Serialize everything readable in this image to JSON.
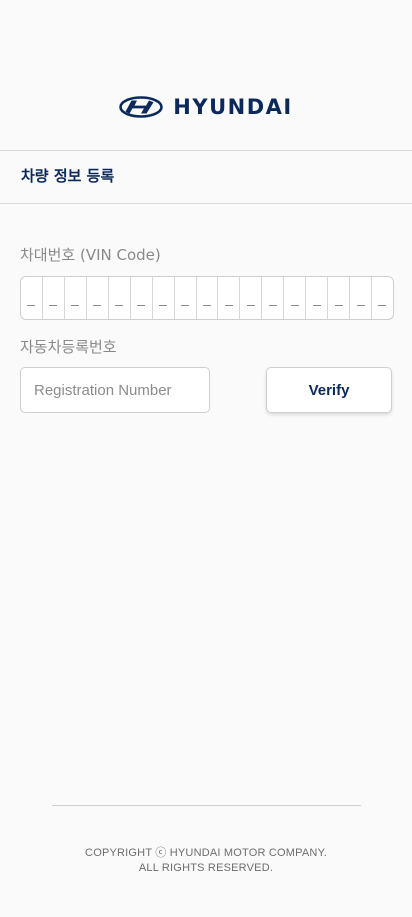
{
  "brand": {
    "name": "HYUNDAI",
    "color": "#0b2a5b"
  },
  "section": {
    "title": "차량 정보 등록"
  },
  "vin": {
    "label": "차대번호 (VIN Code)",
    "cells": [
      "_",
      "_",
      "_",
      "_",
      "_",
      "_",
      "_",
      "_",
      "_",
      "_",
      "_",
      "_",
      "_",
      "_",
      "_",
      "_",
      "_"
    ]
  },
  "registration": {
    "label": "자동차등록번호",
    "placeholder": "Registration Number",
    "value": ""
  },
  "actions": {
    "verify_label": "Verify"
  },
  "footer": {
    "line1": "COPYRIGHT ⓒ HYUNDAI MOTOR COMPANY.",
    "line2": "ALL RIGHTS RESERVED."
  }
}
